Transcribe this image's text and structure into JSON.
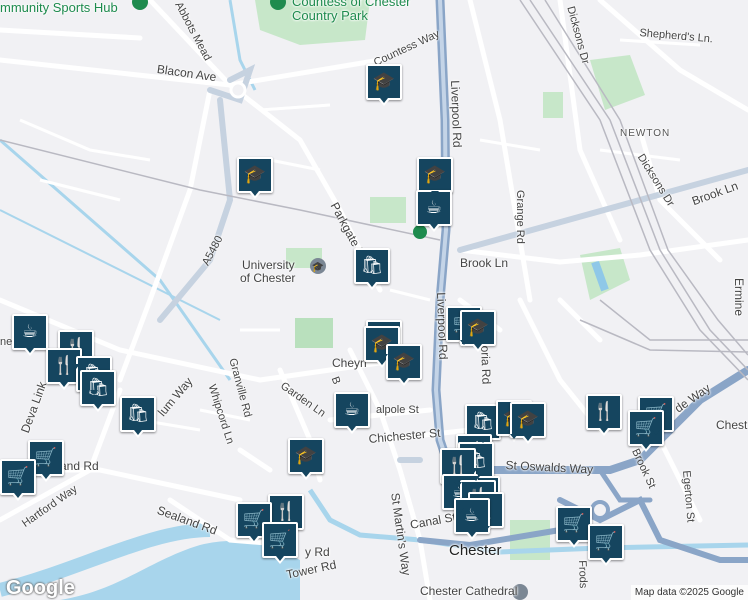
{
  "map": {
    "labels": {
      "sports_hub": "mmunity Sports Hub",
      "country_park_1": "Countess of Chester",
      "country_park_2": "Country Park",
      "countess_way": "Countess Way",
      "abbots_mead": "Abbots Mead",
      "blacon_ave": "Blacon Ave",
      "liverpool_rd_north": "Liverpool Rd",
      "liverpool_rd_south": "Liverpool Rd",
      "shepherds_ln": "Shepherd's Ln.",
      "newton": "NEWTON",
      "dicksons_dr": "Dicksons Dr",
      "dicksons_dr_top": "Dicksons Dr",
      "brook_ln_east": "Brook Ln",
      "brook_ln": "Brook Ln",
      "grange_rd": "Grange Rd",
      "parkgate_rd": "Parkgate Rd",
      "a5480": "A5480",
      "university_1": "University",
      "university_2": "of Chester",
      "cheyney": "Cheyn",
      "victoria_rd": "toria Rd",
      "emmine": "Ermine",
      "chester_east": "Chest",
      "garden_ln": "Garden Ln",
      "walpole_st": "alpole St",
      "granville_rd": "Granville Rd",
      "whipcord_ln": "Whipcord Ln",
      "sealand_rd": "Sealand Rd",
      "harford_way": "Hartford Way",
      "deva_link": "Deva Link",
      "and_rd": "and Rd",
      "lum_way": "lum Way",
      "chichester_st": "Chichester St",
      "st_oswalds_way": "St Oswalds Way",
      "brook_st": "Brook St",
      "egerton_st": "Egerton St",
      "canal_st": "Canal St",
      "st_martins_way": "St Martin's Way",
      "chester": "Chester",
      "tower_rd": "Tower Rd",
      "yy_rd": "y Rd",
      "chester_cathedral": "Chester Cathedral",
      "frodsham": "Frods",
      "ide_way": "de Way",
      "ne": "ne",
      "per": "mpe",
      "b_st": "B"
    },
    "attribution": "Map data ©2025 Google",
    "logo": "Google",
    "colors": {
      "land": "#f1f1f4",
      "park": "#c7e7c9",
      "water": "#a8d5ec",
      "major_road": "#8aa5c7",
      "road": "#ffffff",
      "marker": "#15455f"
    },
    "markers": [
      {
        "name": "school-marker",
        "icon": "graduation-cap-icon",
        "glyph": "🎓"
      },
      {
        "name": "school-marker",
        "icon": "graduation-cap-icon",
        "glyph": "🎓"
      },
      {
        "name": "school-marker",
        "icon": "graduation-cap-icon",
        "glyph": "🎓"
      },
      {
        "name": "cafe-marker",
        "icon": "coffee-cup-icon",
        "glyph": "☕"
      },
      {
        "name": "shopping-marker",
        "icon": "shopping-bag-icon",
        "glyph": "🛍"
      },
      {
        "name": "school-marker",
        "icon": "graduation-cap-icon",
        "glyph": "🎓"
      },
      {
        "name": "school-marker",
        "icon": "graduation-cap-icon",
        "glyph": "🎓"
      },
      {
        "name": "school-marker",
        "icon": "graduation-cap-icon",
        "glyph": "🎓"
      },
      {
        "name": "grocery-marker",
        "icon": "shopping-cart-icon",
        "glyph": "🛒"
      },
      {
        "name": "school-marker",
        "icon": "graduation-cap-icon",
        "glyph": "🎓"
      },
      {
        "name": "cafe-marker",
        "icon": "coffee-cup-icon",
        "glyph": "☕"
      },
      {
        "name": "restaurant-marker",
        "icon": "fork-knife-icon",
        "glyph": "🍴"
      },
      {
        "name": "restaurant-marker",
        "icon": "fork-knife-icon",
        "glyph": "🍴"
      },
      {
        "name": "shopping-marker",
        "icon": "shopping-bag-icon",
        "glyph": "🛍"
      },
      {
        "name": "shopping-marker",
        "icon": "shopping-bag-icon",
        "glyph": "🛍"
      },
      {
        "name": "shopping-marker",
        "icon": "shopping-bag-icon",
        "glyph": "🛍"
      },
      {
        "name": "grocery-marker",
        "icon": "shopping-cart-icon",
        "glyph": "🛒"
      },
      {
        "name": "grocery-marker",
        "icon": "shopping-cart-icon",
        "glyph": "🛒"
      },
      {
        "name": "restaurant-marker",
        "icon": "fork-knife-icon",
        "glyph": "🍴"
      },
      {
        "name": "cafe-marker",
        "icon": "coffee-cup-icon",
        "glyph": "☕"
      },
      {
        "name": "school-marker",
        "icon": "graduation-cap-icon",
        "glyph": "🎓"
      },
      {
        "name": "shopping-marker",
        "icon": "shopping-bag-icon",
        "glyph": "🛍"
      },
      {
        "name": "school-marker",
        "icon": "graduation-cap-icon",
        "glyph": "🎓"
      },
      {
        "name": "school-marker",
        "icon": "graduation-cap-icon",
        "glyph": "🎓"
      },
      {
        "name": "restaurant-marker",
        "icon": "fork-knife-icon",
        "glyph": "🍴"
      },
      {
        "name": "shopping-marker",
        "icon": "shopping-bag-icon",
        "glyph": "🛍"
      },
      {
        "name": "restaurant-marker",
        "icon": "fork-knife-icon",
        "glyph": "🍴"
      },
      {
        "name": "school-marker",
        "icon": "graduation-cap-icon",
        "glyph": "🎓"
      },
      {
        "name": "cafe-marker",
        "icon": "coffee-cup-icon",
        "glyph": "☕"
      },
      {
        "name": "restaurant-marker",
        "icon": "fork-knife-icon",
        "glyph": "🍴"
      },
      {
        "name": "restaurant-marker",
        "icon": "fork-knife-icon",
        "glyph": "🍴"
      },
      {
        "name": "cafe-marker",
        "icon": "coffee-cup-icon",
        "glyph": "☕"
      },
      {
        "name": "grocery-marker",
        "icon": "shopping-cart-icon",
        "glyph": "🛒"
      },
      {
        "name": "grocery-marker",
        "icon": "shopping-cart-icon",
        "glyph": "🛒"
      },
      {
        "name": "restaurant-marker",
        "icon": "fork-knife-icon",
        "glyph": "🍴"
      },
      {
        "name": "grocery-marker",
        "icon": "shopping-cart-icon",
        "glyph": "🛒"
      },
      {
        "name": "grocery-marker",
        "icon": "shopping-cart-icon",
        "glyph": "🛒"
      },
      {
        "name": "grocery-marker",
        "icon": "shopping-cart-icon",
        "glyph": "🛒"
      },
      {
        "name": "grocery-marker",
        "icon": "shopping-cart-icon",
        "glyph": "🛒"
      }
    ]
  }
}
